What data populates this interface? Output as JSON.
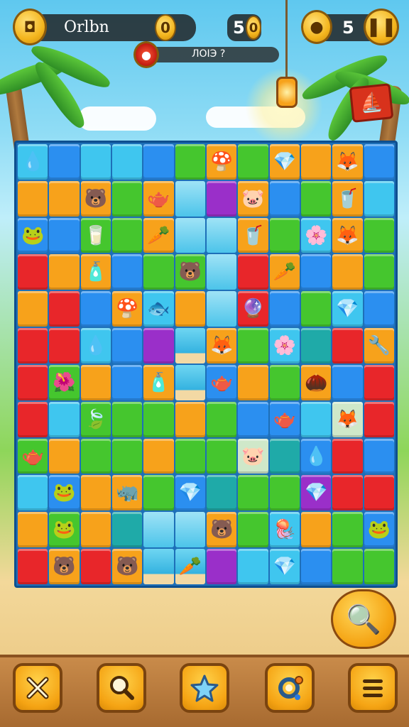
{
  "hud": {
    "player_name": "Orlbn",
    "player_coins": "0",
    "level_number": "5",
    "level_badge": "0",
    "coin_count": "5",
    "progress_label": "ЛОIЭ ?"
  },
  "board": {
    "rows": [
      [
        "c",
        "b",
        "c",
        "c",
        "b",
        "g",
        "o",
        "g",
        "o",
        "o",
        "o",
        "b"
      ],
      [
        "o",
        "o",
        "o",
        "g",
        "o",
        "w",
        "p",
        "o",
        "b",
        "g",
        "o",
        "c"
      ],
      [
        "b",
        "b",
        "g",
        "g",
        "o",
        "w",
        "w",
        "o",
        "g",
        "c",
        "o",
        "g"
      ],
      [
        "r",
        "o",
        "o",
        "b",
        "g",
        "g",
        "w",
        "r",
        "o",
        "b",
        "o",
        "g"
      ],
      [
        "o",
        "r",
        "b",
        "o",
        "c",
        "o",
        "w",
        "r",
        "b",
        "g",
        "c",
        "b"
      ],
      [
        "r",
        "r",
        "c",
        "b",
        "p",
        "s",
        "o",
        "g",
        "c",
        "t",
        "r",
        "o"
      ],
      [
        "r",
        "g",
        "o",
        "b",
        "o",
        "s",
        "b",
        "o",
        "g",
        "o",
        "b",
        "r"
      ],
      [
        "r",
        "c",
        "g",
        "g",
        "g",
        "o",
        "g",
        "b",
        "b",
        "c",
        "x",
        "r"
      ],
      [
        "g",
        "o",
        "g",
        "g",
        "o",
        "g",
        "g",
        "x",
        "t",
        "b",
        "r",
        "b"
      ],
      [
        "c",
        "b",
        "o",
        "o",
        "g",
        "b",
        "t",
        "g",
        "g",
        "p",
        "r",
        "r"
      ],
      [
        "o",
        "g",
        "o",
        "t",
        "w",
        "w",
        "o",
        "g",
        "c",
        "o",
        "g",
        "b"
      ],
      [
        "r",
        "o",
        "r",
        "o",
        "s",
        "s",
        "p",
        "c",
        "c",
        "b",
        "g",
        "g"
      ]
    ],
    "items": [
      {
        "r": 0,
        "c": 0,
        "icon": "water-drop-icon",
        "glyph": "💧"
      },
      {
        "r": 0,
        "c": 6,
        "icon": "mushroom-icon",
        "glyph": "🍄"
      },
      {
        "r": 0,
        "c": 8,
        "icon": "gem-icon",
        "glyph": "💎"
      },
      {
        "r": 0,
        "c": 10,
        "icon": "fox-icon",
        "glyph": "🦊"
      },
      {
        "r": 1,
        "c": 2,
        "icon": "bear-icon",
        "glyph": "🐻"
      },
      {
        "r": 1,
        "c": 4,
        "icon": "pot-icon",
        "glyph": "🫖"
      },
      {
        "r": 1,
        "c": 7,
        "icon": "pig-icon",
        "glyph": "🐷"
      },
      {
        "r": 1,
        "c": 10,
        "icon": "cup-icon",
        "glyph": "🥤"
      },
      {
        "r": 2,
        "c": 0,
        "icon": "frog-icon",
        "glyph": "🐸"
      },
      {
        "r": 2,
        "c": 2,
        "icon": "jar-icon",
        "glyph": "🥛"
      },
      {
        "r": 2,
        "c": 4,
        "icon": "carrot-icon",
        "glyph": "🥕"
      },
      {
        "r": 2,
        "c": 7,
        "icon": "cup-icon",
        "glyph": "🥤"
      },
      {
        "r": 2,
        "c": 9,
        "icon": "flower-icon",
        "glyph": "🌸"
      },
      {
        "r": 2,
        "c": 10,
        "icon": "fox-icon",
        "glyph": "🦊"
      },
      {
        "r": 3,
        "c": 2,
        "icon": "bottle-icon",
        "glyph": "🧴"
      },
      {
        "r": 3,
        "c": 5,
        "icon": "bear-icon",
        "glyph": "🐻"
      },
      {
        "r": 3,
        "c": 8,
        "icon": "carrot-icon",
        "glyph": "🥕"
      },
      {
        "r": 4,
        "c": 3,
        "icon": "mushroom-icon",
        "glyph": "🍄"
      },
      {
        "r": 4,
        "c": 4,
        "icon": "fish-icon",
        "glyph": "🐟"
      },
      {
        "r": 4,
        "c": 7,
        "icon": "crystal-icon",
        "glyph": "🔮"
      },
      {
        "r": 4,
        "c": 10,
        "icon": "gem-icon",
        "glyph": "💎"
      },
      {
        "r": 5,
        "c": 2,
        "icon": "water-drop-icon",
        "glyph": "💧"
      },
      {
        "r": 5,
        "c": 6,
        "icon": "fox-icon",
        "glyph": "🦊"
      },
      {
        "r": 5,
        "c": 8,
        "icon": "flower-icon",
        "glyph": "🌸"
      },
      {
        "r": 5,
        "c": 11,
        "icon": "pipe-icon",
        "glyph": "🔧"
      },
      {
        "r": 6,
        "c": 1,
        "icon": "flower-icon",
        "glyph": "🌺"
      },
      {
        "r": 6,
        "c": 4,
        "icon": "bottle-icon",
        "glyph": "🧴"
      },
      {
        "r": 6,
        "c": 6,
        "icon": "pot-icon",
        "glyph": "🫖"
      },
      {
        "r": 6,
        "c": 9,
        "icon": "acorn-icon",
        "glyph": "🌰"
      },
      {
        "r": 7,
        "c": 2,
        "icon": "leaf-icon",
        "glyph": "🍃"
      },
      {
        "r": 7,
        "c": 8,
        "icon": "pot-icon",
        "glyph": "🫖"
      },
      {
        "r": 7,
        "c": 10,
        "icon": "fox-icon",
        "glyph": "🦊"
      },
      {
        "r": 8,
        "c": 0,
        "icon": "pot-icon",
        "glyph": "🫖"
      },
      {
        "r": 8,
        "c": 7,
        "icon": "pig-icon",
        "glyph": "🐷"
      },
      {
        "r": 8,
        "c": 9,
        "icon": "water-drop-icon",
        "glyph": "💧"
      },
      {
        "r": 9,
        "c": 1,
        "icon": "frog-icon",
        "glyph": "🐸"
      },
      {
        "r": 9,
        "c": 3,
        "icon": "rhino-icon",
        "glyph": "🦏"
      },
      {
        "r": 9,
        "c": 5,
        "icon": "gem-icon",
        "glyph": "💎"
      },
      {
        "r": 9,
        "c": 9,
        "icon": "gem-icon",
        "glyph": "💎"
      },
      {
        "r": 10,
        "c": 1,
        "icon": "frog-icon",
        "glyph": "🐸"
      },
      {
        "r": 10,
        "c": 6,
        "icon": "bear-icon",
        "glyph": "🐻"
      },
      {
        "r": 10,
        "c": 8,
        "icon": "jellyfish-icon",
        "glyph": "🪼"
      },
      {
        "r": 10,
        "c": 11,
        "icon": "frog-icon",
        "glyph": "🐸"
      },
      {
        "r": 11,
        "c": 1,
        "icon": "bear-icon",
        "glyph": "🐻"
      },
      {
        "r": 11,
        "c": 3,
        "icon": "bear-icon",
        "glyph": "🐻"
      },
      {
        "r": 11,
        "c": 5,
        "icon": "carrot-icon",
        "glyph": "🥕"
      },
      {
        "r": 11,
        "c": 8,
        "icon": "gem-icon",
        "glyph": "💎"
      }
    ]
  },
  "toolbar": {
    "buttons": [
      {
        "name": "close-icon"
      },
      {
        "name": "search-icon"
      },
      {
        "name": "star-icon"
      },
      {
        "name": "settings-gear-icon"
      },
      {
        "name": "menu-icon"
      }
    ]
  },
  "colors": {
    "accent": "#f5a414",
    "board_border": "#0e4f8f"
  }
}
